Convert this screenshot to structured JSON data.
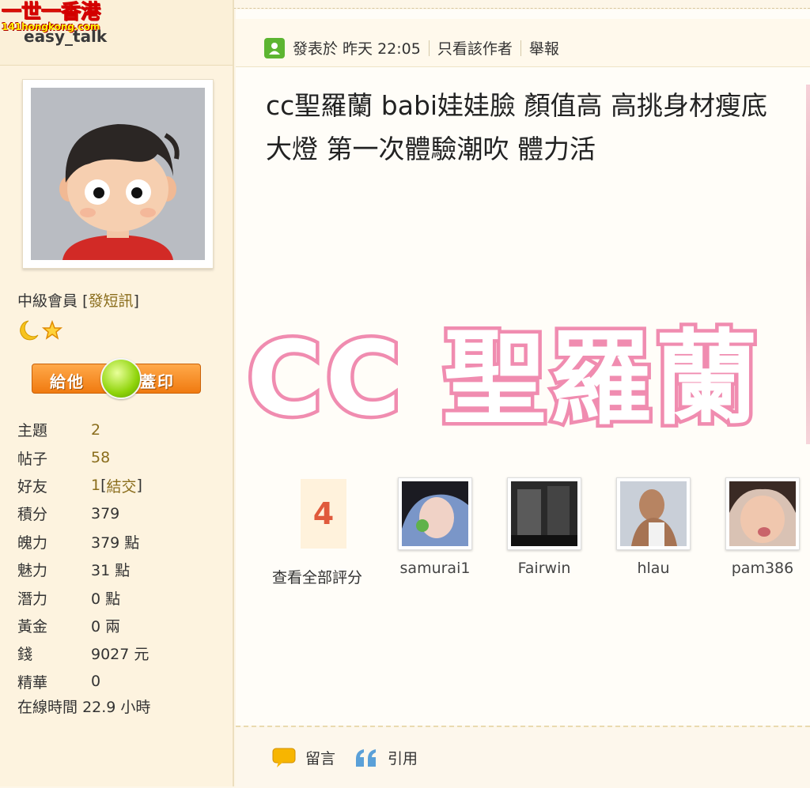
{
  "site_logo": {
    "line1": "一世一香港",
    "line2": "141hongkong.com"
  },
  "user": {
    "name": "easy_talk",
    "rank_label": "中級會員",
    "send_pm": "發短訊",
    "stamp_give": "給他",
    "stamp_seal": "蓋印",
    "stats": [
      {
        "label": "主題",
        "value": "2",
        "link": true
      },
      {
        "label": "帖子",
        "value": "58",
        "link": true
      },
      {
        "label": "好友",
        "value": "1",
        "link": true,
        "extra": "結交"
      },
      {
        "label": "積分",
        "value": "379"
      },
      {
        "label": "魄力",
        "value": "379 點"
      },
      {
        "label": "魅力",
        "value": "31 點"
      },
      {
        "label": "潛力",
        "value": "0 點"
      },
      {
        "label": "黃金",
        "value": "0 兩"
      },
      {
        "label": "錢",
        "value": "9027 元"
      },
      {
        "label": "精華",
        "value": "0"
      }
    ],
    "online_label": "在線時間",
    "online_value": "22.9 小時"
  },
  "post": {
    "posted_at": "發表於 昨天 22:05",
    "only_author": "只看該作者",
    "report": "舉報",
    "title": "cc聖羅蘭 babi娃娃臉 顏值高 高挑身材瘦底大燈 第一次體驗潮吹 體力活",
    "banner_text": "CC 聖羅蘭",
    "rating_count": "4",
    "view_all_ratings": "查看全部評分",
    "raters": [
      "samurai1",
      "Fairwin",
      "hlau",
      "pam386"
    ],
    "comment_label": "留言",
    "quote_label": "引用"
  },
  "colors": {
    "page_bg": "#fdf6e8",
    "sidebar_bg": "#fdf3df",
    "link_gold": "#8a6d1c",
    "banner_pink": "#f08cb0",
    "rating_red": "#e05a3c",
    "stamp_orange": "#f07a10"
  },
  "icons": [
    "online-status-icon",
    "moon-icon",
    "star-icon",
    "comment-icon",
    "quote-icon"
  ]
}
